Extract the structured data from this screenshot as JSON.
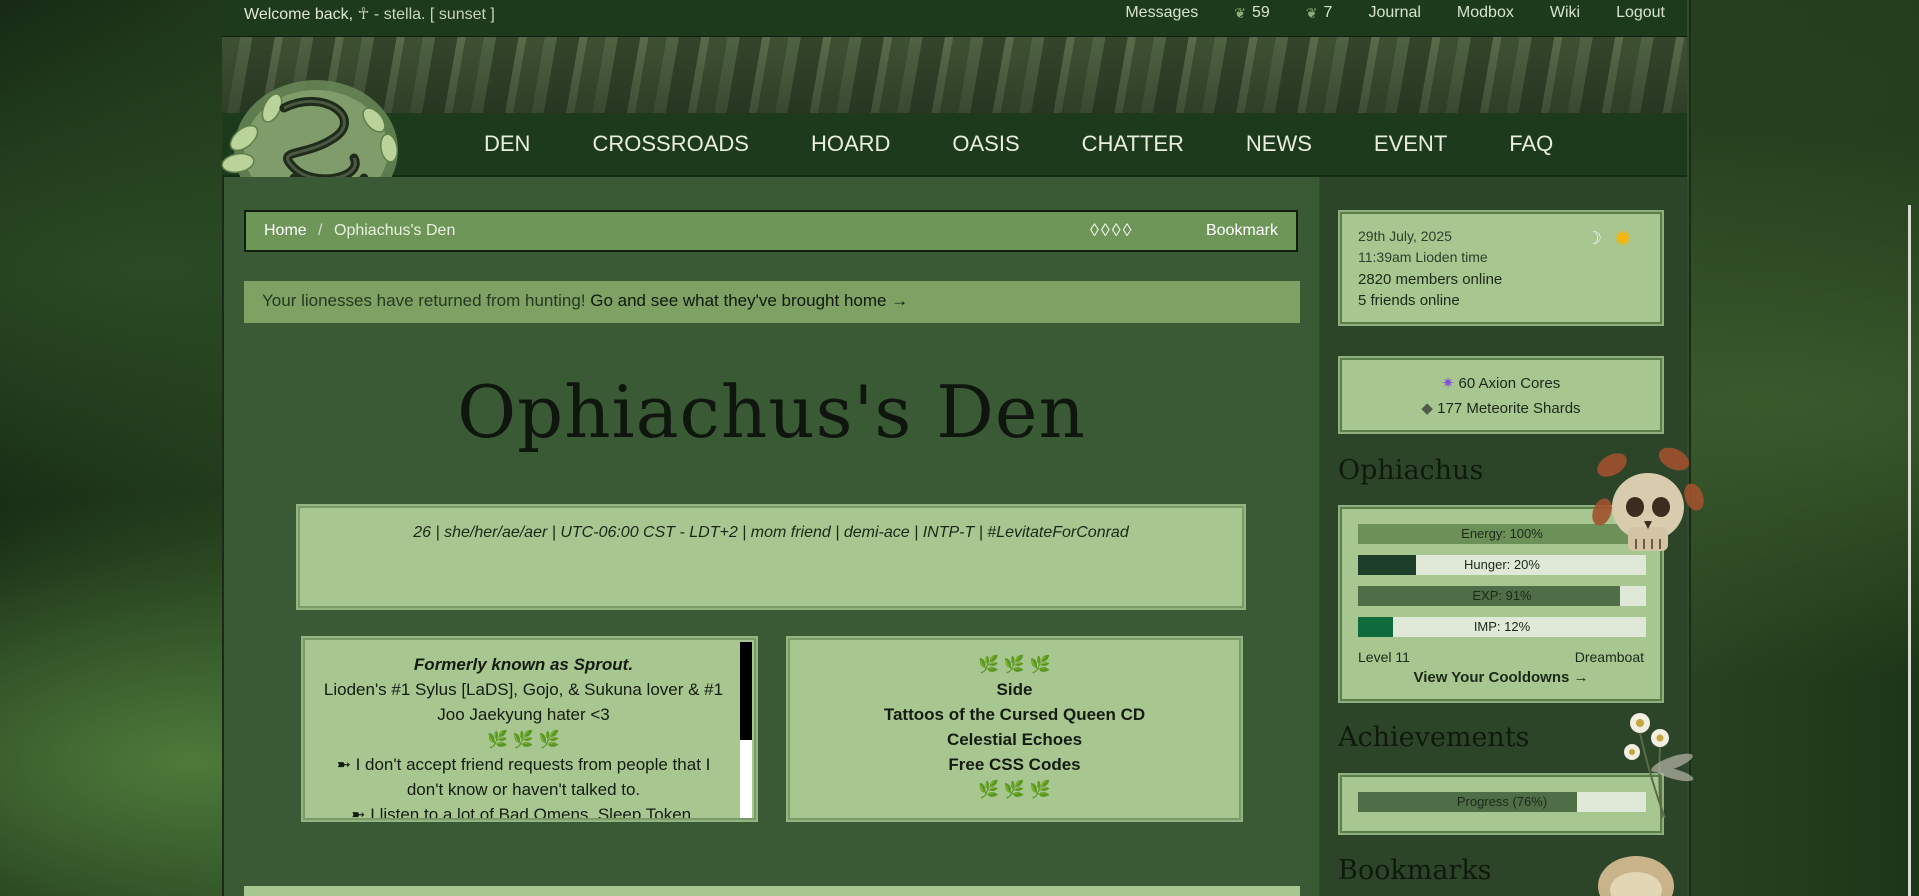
{
  "topbar": {
    "welcome_prefix": "Welcome back,",
    "username": "☥ - stella. [ sunset ]",
    "nav": [
      {
        "label": "Messages"
      },
      {
        "label": "59",
        "icon": "leaf-icon"
      },
      {
        "label": "7",
        "icon": "leaf-icon"
      },
      {
        "label": "Journal"
      },
      {
        "label": "Modbox"
      },
      {
        "label": "Wiki"
      },
      {
        "label": "Logout"
      }
    ]
  },
  "mainnav": [
    "DEN",
    "CROSSROADS",
    "HOARD",
    "OASIS",
    "CHATTER",
    "NEWS",
    "EVENT",
    "FAQ"
  ],
  "breadcrumb": {
    "home": "Home",
    "separator": "/",
    "current": "Ophiachus's Den",
    "diamonds": "◊◊◊◊",
    "bookmark": "Bookmark"
  },
  "notice": {
    "text": "Your lionesses have returned from hunting!",
    "link": "Go and see what they've brought home →"
  },
  "den": {
    "title": "Ophiachus's Den",
    "bio": "26 | she/her/ae/aer | UTC-06:00 CST - LDT+2 | mom friend | demi-ace | INTP-T | #LevitateForConrad"
  },
  "left_panel": {
    "line1": "Formerly known as Sprout.",
    "line2": "Lioden's #1 Sylus [LaDS], Gojo, & Sukuna lover & #1",
    "line3": "Joo Jaekyung hater <3",
    "line4": "🌿 🌿 🌿",
    "line5": "➼ I don't accept friend requests from people that I",
    "line6": "don't know or haven't talked to.",
    "line7": "➼ I listen to a lot of Bad Omens, Sleep Token,"
  },
  "right_panel": {
    "line1": "🌿 🌿 🌿",
    "line2": "Side",
    "line3": "Tattoos of the Cursed Queen CD",
    "line4": "Celestial Echoes",
    "line5": "Free CSS Codes",
    "line6": "🌿 🌿 🌿"
  },
  "time_box": {
    "date": "29th July, 2025",
    "time": "11:39am Lioden time",
    "members": "2820 members online",
    "friends": "5 friends online"
  },
  "currency": {
    "cores": "60 Axion Cores",
    "shards": "177 Meteorite Shards"
  },
  "profile": {
    "heading": "Ophiachus",
    "bars": [
      {
        "label": "Energy: 100%",
        "value": 100,
        "color": "#6c9158"
      },
      {
        "label": "Hunger: 20%",
        "value": 20,
        "color": "#1d3f2a"
      },
      {
        "label": "EXP: 91%",
        "value": 91,
        "color": "#4f6e47"
      },
      {
        "label": "IMP: 12%",
        "value": 12,
        "color": "#0f6a3c"
      }
    ],
    "level": "Level 11",
    "rank": "Dreamboat",
    "cooldowns": "View Your Cooldowns →"
  },
  "achievements": {
    "heading": "Achievements",
    "progress_label": "Progress (76%)",
    "progress": 76
  },
  "bookmarks": {
    "heading": "Bookmarks"
  },
  "colors": {
    "frame": "#324c2e",
    "nav_bg": "#1e3a1d",
    "panel_bg": "#a8c690",
    "breadcrumb_bg": "#6d9658",
    "notice_bg": "#7fa164"
  }
}
